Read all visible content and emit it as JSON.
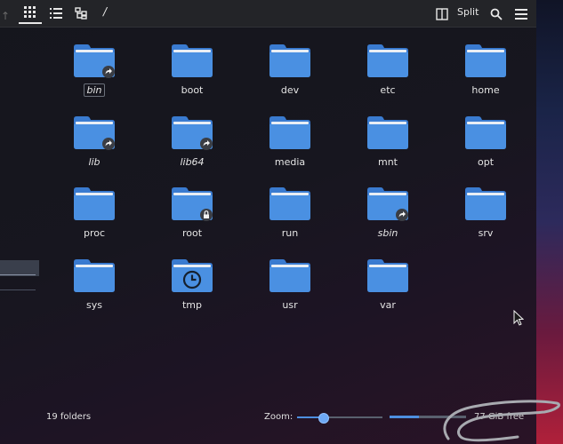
{
  "toolbar": {
    "back_icon": "arrow-up-icon",
    "view_icons": "icons-view-icon",
    "view_details": "details-view-icon",
    "view_tree": "tree-view-icon",
    "location": "/",
    "split_label": "Split",
    "search_icon": "search-icon",
    "menu_icon": "hamburger-menu-icon"
  },
  "folders": [
    {
      "label": "bin",
      "badge": "link",
      "italic": true,
      "selected": true
    },
    {
      "label": "boot",
      "badge": "",
      "italic": false
    },
    {
      "label": "dev",
      "badge": "",
      "italic": false
    },
    {
      "label": "etc",
      "badge": "",
      "italic": false
    },
    {
      "label": "home",
      "badge": "",
      "italic": false
    },
    {
      "label": "lib",
      "badge": "link",
      "italic": true
    },
    {
      "label": "lib64",
      "badge": "link",
      "italic": true
    },
    {
      "label": "media",
      "badge": "",
      "italic": false
    },
    {
      "label": "mnt",
      "badge": "",
      "italic": false
    },
    {
      "label": "opt",
      "badge": "",
      "italic": false
    },
    {
      "label": "proc",
      "badge": "",
      "italic": false
    },
    {
      "label": "root",
      "badge": "lock",
      "italic": false
    },
    {
      "label": "run",
      "badge": "",
      "italic": false
    },
    {
      "label": "sbin",
      "badge": "link",
      "italic": true
    },
    {
      "label": "srv",
      "badge": "",
      "italic": false
    },
    {
      "label": "sys",
      "badge": "",
      "italic": false
    },
    {
      "label": "tmp",
      "badge": "clock",
      "italic": false
    },
    {
      "label": "usr",
      "badge": "",
      "italic": false
    },
    {
      "label": "var",
      "badge": "",
      "italic": false
    }
  ],
  "status": {
    "count": "19 folders",
    "zoom_label": "Zoom:",
    "zoom_level": 0.3,
    "free_space_label": "77 GiB free",
    "free_space_used": 0.38
  },
  "colors": {
    "folder_body": "#4a90e2",
    "folder_tab": "#3a7bd0",
    "accent": "#4d8fe0"
  }
}
